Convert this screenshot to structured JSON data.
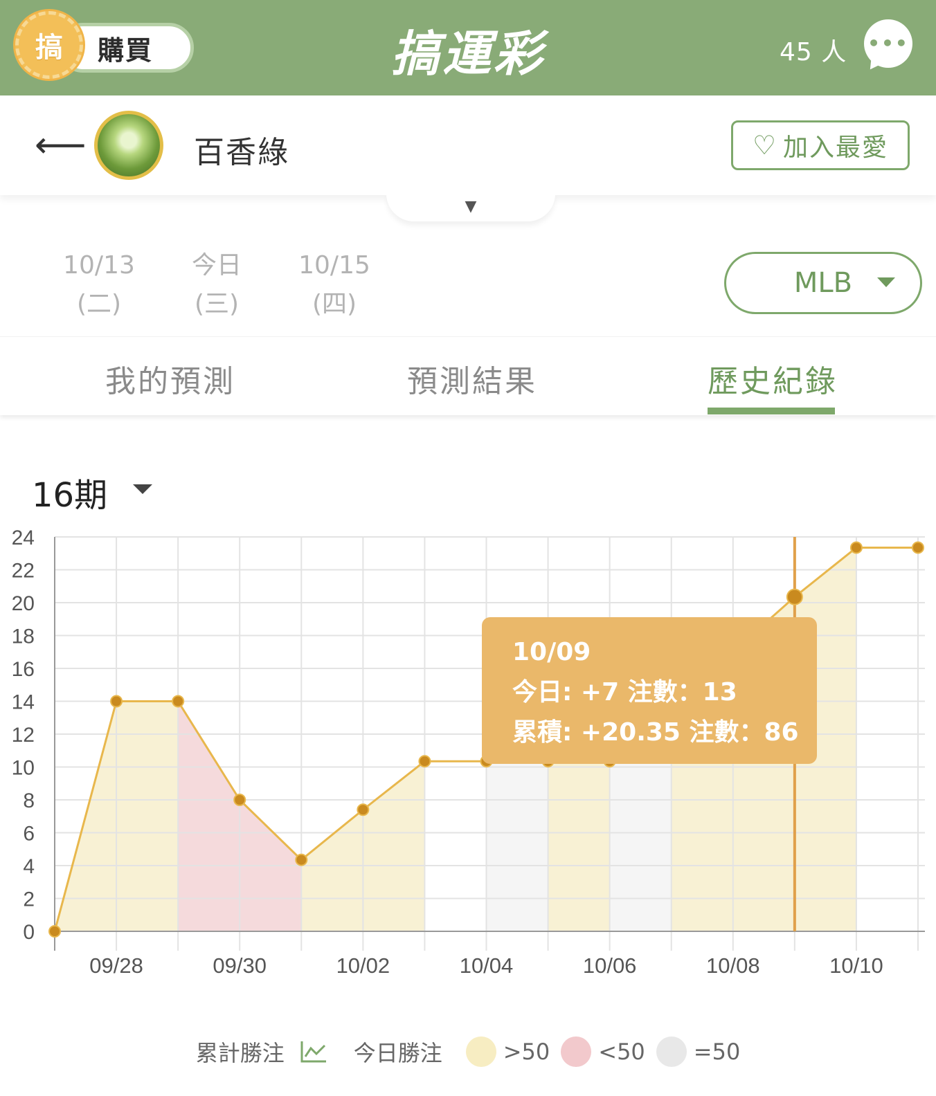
{
  "topbar": {
    "coin_label": "搞",
    "buy_label": "購買",
    "logo": "搞運彩",
    "online_count": "45 人",
    "chat_icon": "chat-bubble-icon"
  },
  "profile": {
    "back_icon": "arrow-left-icon",
    "username": "百香綠",
    "favorite_label": "加入最愛",
    "favorite_icon": "heart-icon",
    "expand_icon": "caret-down-icon"
  },
  "dates": [
    {
      "date": "10/13",
      "weekday": "(二)"
    },
    {
      "date": "今日",
      "weekday": "(三)"
    },
    {
      "date": "10/15",
      "weekday": "(四)"
    }
  ],
  "league": {
    "selected": "MLB"
  },
  "tabs": [
    {
      "label": "我的預測",
      "active": false
    },
    {
      "label": "預測結果",
      "active": false
    },
    {
      "label": "歷史紀錄",
      "active": true
    }
  ],
  "period": {
    "selected": "16期"
  },
  "tooltip": {
    "date": "10/09",
    "today_line": "今日: +7 注數：13",
    "total_line": "累積: +20.35 注數：86"
  },
  "legend": {
    "cumulative": "累計勝注",
    "today": "今日勝注",
    "gt50": ">50",
    "lt50": "<50",
    "eq50": "=50"
  },
  "colors": {
    "brand_green": "#89ab77",
    "accent_green": "#6f9a5d",
    "line_orange": "#e8b74c",
    "point_brown": "#c98a1f",
    "fill_gt50": "#f7efcc",
    "fill_lt50": "#f3d3d6",
    "fill_eq50": "#f3f3f3",
    "tooltip_bg": "#eab86a"
  },
  "chart_data": {
    "type": "line",
    "x": [
      "09/27",
      "09/28",
      "09/29",
      "09/30",
      "10/01",
      "10/02",
      "10/03",
      "10/04",
      "10/05",
      "10/06",
      "10/07",
      "10/08",
      "10/09",
      "10/10",
      "10/11"
    ],
    "x_tick_labels": [
      "09/28",
      "09/30",
      "10/02",
      "10/04",
      "10/06",
      "10/08",
      "10/10"
    ],
    "series": [
      {
        "name": "累計勝注",
        "values": [
          0,
          14,
          14,
          8,
          4.35,
          7.4,
          10.35,
          10.35,
          10.35,
          10.35,
          null,
          null,
          20.35,
          23.35,
          23.35
        ]
      }
    ],
    "band_categories": [
      "gt50",
      "gt50",
      "lt50",
      "lt50",
      "gt50",
      "gt50",
      "none",
      "eq50",
      "gt50",
      "eq50",
      "gt50",
      "gt50",
      "gt50",
      "none"
    ],
    "ylim": [
      0,
      24
    ],
    "yticks": [
      0,
      2,
      4,
      6,
      8,
      10,
      12,
      14,
      16,
      18,
      20,
      22,
      24
    ],
    "grid": true,
    "highlight_x": "10/09",
    "legend_position": "bottom"
  }
}
